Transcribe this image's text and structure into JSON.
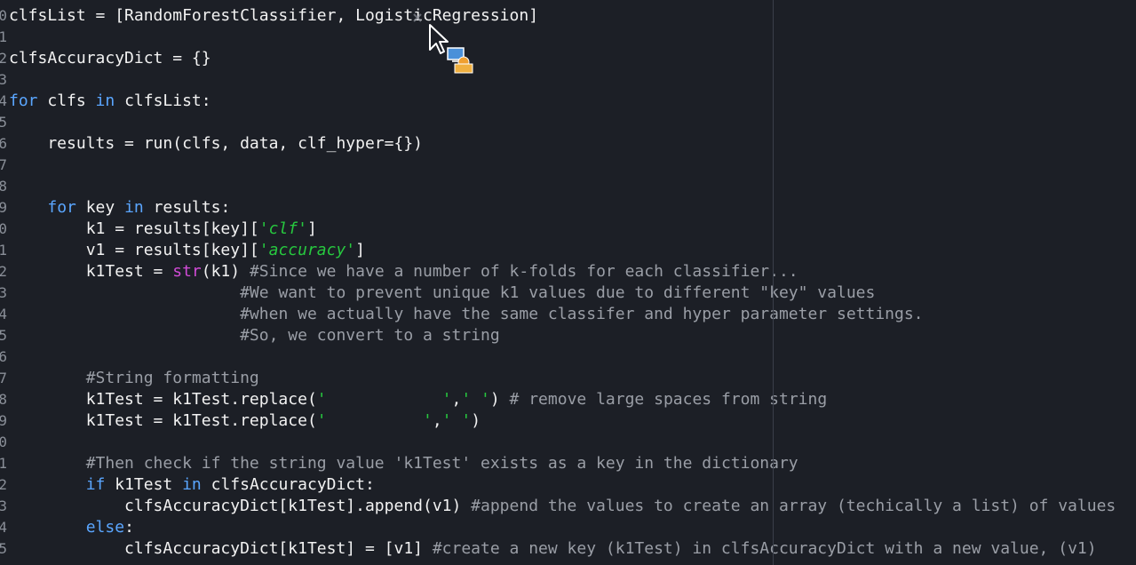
{
  "gutter": {
    "line_numbers": [
      "0",
      "1",
      "2",
      "3",
      "4",
      "5",
      "6",
      "7",
      "8",
      "9",
      "0",
      "1",
      "2",
      "3",
      "4",
      "5",
      "6",
      "7",
      "8",
      "9",
      "0",
      "1",
      "2",
      "3",
      "4",
      "5"
    ]
  },
  "code": {
    "lines": [
      [
        {
          "t": "plain",
          "v": "clfsList = [RandomForestClassifier, LogisticRegression]"
        }
      ],
      [],
      [
        {
          "t": "plain",
          "v": "clfsAccuracyDict = {}"
        }
      ],
      [],
      [
        {
          "t": "keyword",
          "v": "for"
        },
        {
          "t": "plain",
          "v": " clfs "
        },
        {
          "t": "keyword",
          "v": "in"
        },
        {
          "t": "plain",
          "v": " clfsList:"
        }
      ],
      [],
      [
        {
          "t": "plain",
          "v": "    results = run(clfs, data, clf_hyper={})"
        }
      ],
      [],
      [],
      [
        {
          "t": "plain",
          "v": "    "
        },
        {
          "t": "keyword",
          "v": "for"
        },
        {
          "t": "plain",
          "v": " key "
        },
        {
          "t": "keyword",
          "v": "in"
        },
        {
          "t": "plain",
          "v": " results:"
        }
      ],
      [
        {
          "t": "plain",
          "v": "        k1 = results[key]["
        },
        {
          "t": "string",
          "v": "'clf'"
        },
        {
          "t": "plain",
          "v": "]"
        }
      ],
      [
        {
          "t": "plain",
          "v": "        v1 = results[key]["
        },
        {
          "t": "string",
          "v": "'accuracy'"
        },
        {
          "t": "plain",
          "v": "]"
        }
      ],
      [
        {
          "t": "plain",
          "v": "        k1Test = "
        },
        {
          "t": "builtin",
          "v": "str"
        },
        {
          "t": "plain",
          "v": "(k1) "
        },
        {
          "t": "comment",
          "v": "#Since we have a number of k-folds for each classifier..."
        }
      ],
      [
        {
          "t": "plain",
          "v": "                        "
        },
        {
          "t": "comment",
          "v": "#We want to prevent unique k1 values due to different \"key\" values"
        }
      ],
      [
        {
          "t": "plain",
          "v": "                        "
        },
        {
          "t": "comment",
          "v": "#when we actually have the same classifer and hyper parameter settings."
        }
      ],
      [
        {
          "t": "plain",
          "v": "                        "
        },
        {
          "t": "comment",
          "v": "#So, we convert to a string"
        }
      ],
      [],
      [
        {
          "t": "plain",
          "v": "        "
        },
        {
          "t": "comment",
          "v": "#String formatting"
        }
      ],
      [
        {
          "t": "plain",
          "v": "        k1Test = k1Test.replace("
        },
        {
          "t": "string",
          "v": "'            '"
        },
        {
          "t": "plain",
          "v": ","
        },
        {
          "t": "string",
          "v": "' '"
        },
        {
          "t": "plain",
          "v": ") "
        },
        {
          "t": "comment",
          "v": "# remove large spaces from string"
        }
      ],
      [
        {
          "t": "plain",
          "v": "        k1Test = k1Test.replace("
        },
        {
          "t": "string",
          "v": "'          '"
        },
        {
          "t": "plain",
          "v": ","
        },
        {
          "t": "string",
          "v": "' '"
        },
        {
          "t": "plain",
          "v": ")"
        }
      ],
      [],
      [
        {
          "t": "plain",
          "v": "        "
        },
        {
          "t": "comment",
          "v": "#Then check if the string value 'k1Test' exists as a key in the dictionary"
        }
      ],
      [
        {
          "t": "plain",
          "v": "        "
        },
        {
          "t": "keyword",
          "v": "if"
        },
        {
          "t": "plain",
          "v": " k1Test "
        },
        {
          "t": "keyword",
          "v": "in"
        },
        {
          "t": "plain",
          "v": " clfsAccuracyDict:"
        }
      ],
      [
        {
          "t": "plain",
          "v": "            clfsAccuracyDict[k1Test].append(v1) "
        },
        {
          "t": "comment",
          "v": "#append the values to create an array (techically a list) of values"
        }
      ],
      [
        {
          "t": "plain",
          "v": "        "
        },
        {
          "t": "keyword",
          "v": "else"
        },
        {
          "t": "plain",
          "v": ":"
        }
      ],
      [
        {
          "t": "plain",
          "v": "            clfsAccuracyDict[k1Test] = [v1] "
        },
        {
          "t": "comment",
          "v": "#create a new key (k1Test) in clfsAccuracyDict with a new value, (v1)"
        }
      ]
    ]
  },
  "colors": {
    "background": "#1c1f26",
    "keyword": "#5aa6ff",
    "builtin": "#d14bd6",
    "string": "#27c93f",
    "comment": "#9a9ea6",
    "text": "#f2f2f2"
  },
  "icons": {
    "cursor": "busy-arrow-cursor-icon"
  }
}
